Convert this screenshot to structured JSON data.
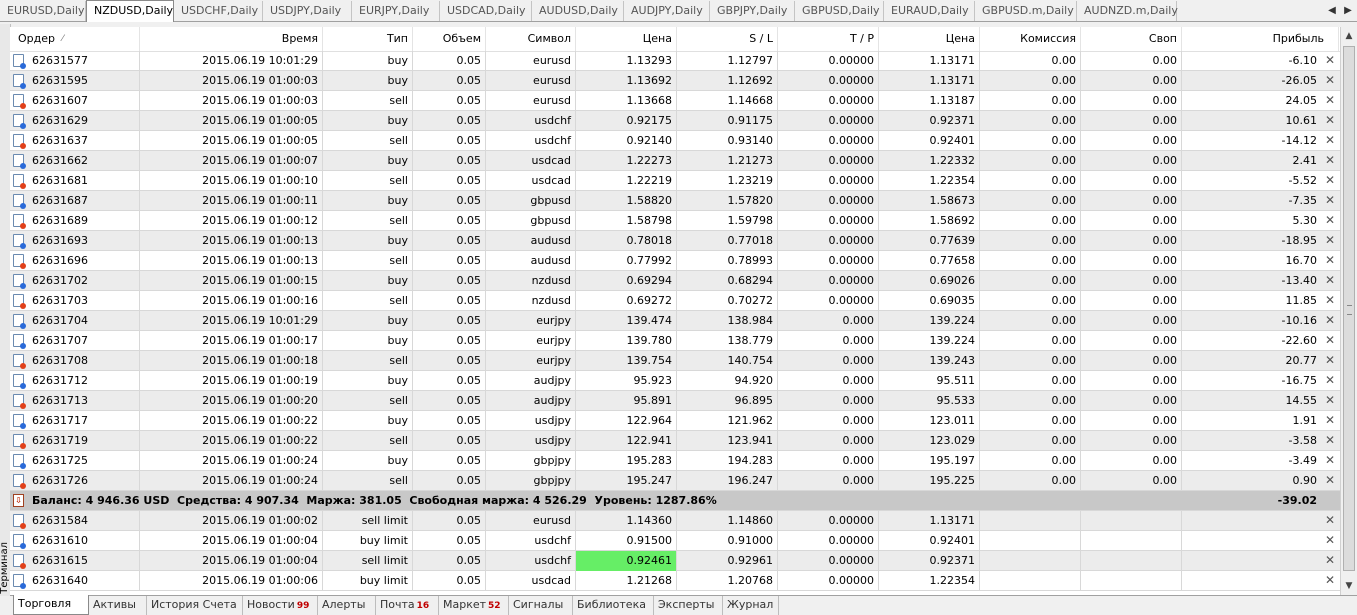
{
  "chart_tabs": [
    "EURUSD,Daily",
    "NZDUSD,Daily",
    "USDCHF,Daily",
    "USDJPY,Daily",
    "EURJPY,Daily",
    "USDCAD,Daily",
    "AUDUSD,Daily",
    "AUDJPY,Daily",
    "GBPJPY,Daily",
    "GBPUSD,Daily",
    "EURAUD,Daily",
    "GBPUSD.m,Daily",
    "AUDNZD.m,Daily"
  ],
  "chart_tabs_active": 1,
  "tab_arrows": {
    "left": "◀",
    "right": "▶"
  },
  "columns": {
    "order": "Ордер",
    "sort_indicator": "⁄",
    "time": "Время",
    "type": "Тип",
    "volume": "Объем",
    "symbol": "Символ",
    "price": "Цена",
    "sl": "S / L",
    "tp": "T / P",
    "cur_price": "Цена",
    "commission": "Комиссия",
    "swap": "Своп",
    "profit": "Прибыль"
  },
  "trades": [
    {
      "order": "62631577",
      "time": "2015.06.19 10:01:29",
      "type": "buy",
      "volume": "0.05",
      "symbol": "eurusd",
      "price": "1.13293",
      "sl": "1.12797",
      "tp": "0.00000",
      "cur_price": "1.13171",
      "commission": "0.00",
      "swap": "0.00",
      "profit": "-6.10"
    },
    {
      "order": "62631595",
      "time": "2015.06.19 01:00:03",
      "type": "buy",
      "volume": "0.05",
      "symbol": "eurusd",
      "price": "1.13692",
      "sl": "1.12692",
      "tp": "0.00000",
      "cur_price": "1.13171",
      "commission": "0.00",
      "swap": "0.00",
      "profit": "-26.05"
    },
    {
      "order": "62631607",
      "time": "2015.06.19 01:00:03",
      "type": "sell",
      "volume": "0.05",
      "symbol": "eurusd",
      "price": "1.13668",
      "sl": "1.14668",
      "tp": "0.00000",
      "cur_price": "1.13187",
      "commission": "0.00",
      "swap": "0.00",
      "profit": "24.05"
    },
    {
      "order": "62631629",
      "time": "2015.06.19 01:00:05",
      "type": "buy",
      "volume": "0.05",
      "symbol": "usdchf",
      "price": "0.92175",
      "sl": "0.91175",
      "tp": "0.00000",
      "cur_price": "0.92371",
      "commission": "0.00",
      "swap": "0.00",
      "profit": "10.61"
    },
    {
      "order": "62631637",
      "time": "2015.06.19 01:00:05",
      "type": "sell",
      "volume": "0.05",
      "symbol": "usdchf",
      "price": "0.92140",
      "sl": "0.93140",
      "tp": "0.00000",
      "cur_price": "0.92401",
      "commission": "0.00",
      "swap": "0.00",
      "profit": "-14.12"
    },
    {
      "order": "62631662",
      "time": "2015.06.19 01:00:07",
      "type": "buy",
      "volume": "0.05",
      "symbol": "usdcad",
      "price": "1.22273",
      "sl": "1.21273",
      "tp": "0.00000",
      "cur_price": "1.22332",
      "commission": "0.00",
      "swap": "0.00",
      "profit": "2.41"
    },
    {
      "order": "62631681",
      "time": "2015.06.19 01:00:10",
      "type": "sell",
      "volume": "0.05",
      "symbol": "usdcad",
      "price": "1.22219",
      "sl": "1.23219",
      "tp": "0.00000",
      "cur_price": "1.22354",
      "commission": "0.00",
      "swap": "0.00",
      "profit": "-5.52"
    },
    {
      "order": "62631687",
      "time": "2015.06.19 01:00:11",
      "type": "buy",
      "volume": "0.05",
      "symbol": "gbpusd",
      "price": "1.58820",
      "sl": "1.57820",
      "tp": "0.00000",
      "cur_price": "1.58673",
      "commission": "0.00",
      "swap": "0.00",
      "profit": "-7.35"
    },
    {
      "order": "62631689",
      "time": "2015.06.19 01:00:12",
      "type": "sell",
      "volume": "0.05",
      "symbol": "gbpusd",
      "price": "1.58798",
      "sl": "1.59798",
      "tp": "0.00000",
      "cur_price": "1.58692",
      "commission": "0.00",
      "swap": "0.00",
      "profit": "5.30"
    },
    {
      "order": "62631693",
      "time": "2015.06.19 01:00:13",
      "type": "buy",
      "volume": "0.05",
      "symbol": "audusd",
      "price": "0.78018",
      "sl": "0.77018",
      "tp": "0.00000",
      "cur_price": "0.77639",
      "commission": "0.00",
      "swap": "0.00",
      "profit": "-18.95"
    },
    {
      "order": "62631696",
      "time": "2015.06.19 01:00:13",
      "type": "sell",
      "volume": "0.05",
      "symbol": "audusd",
      "price": "0.77992",
      "sl": "0.78993",
      "tp": "0.00000",
      "cur_price": "0.77658",
      "commission": "0.00",
      "swap": "0.00",
      "profit": "16.70"
    },
    {
      "order": "62631702",
      "time": "2015.06.19 01:00:15",
      "type": "buy",
      "volume": "0.05",
      "symbol": "nzdusd",
      "price": "0.69294",
      "sl": "0.68294",
      "tp": "0.00000",
      "cur_price": "0.69026",
      "commission": "0.00",
      "swap": "0.00",
      "profit": "-13.40"
    },
    {
      "order": "62631703",
      "time": "2015.06.19 01:00:16",
      "type": "sell",
      "volume": "0.05",
      "symbol": "nzdusd",
      "price": "0.69272",
      "sl": "0.70272",
      "tp": "0.00000",
      "cur_price": "0.69035",
      "commission": "0.00",
      "swap": "0.00",
      "profit": "11.85"
    },
    {
      "order": "62631704",
      "time": "2015.06.19 10:01:29",
      "type": "buy",
      "volume": "0.05",
      "symbol": "eurjpy",
      "price": "139.474",
      "sl": "138.984",
      "tp": "0.000",
      "cur_price": "139.224",
      "commission": "0.00",
      "swap": "0.00",
      "profit": "-10.16"
    },
    {
      "order": "62631707",
      "time": "2015.06.19 01:00:17",
      "type": "buy",
      "volume": "0.05",
      "symbol": "eurjpy",
      "price": "139.780",
      "sl": "138.779",
      "tp": "0.000",
      "cur_price": "139.224",
      "commission": "0.00",
      "swap": "0.00",
      "profit": "-22.60"
    },
    {
      "order": "62631708",
      "time": "2015.06.19 01:00:18",
      "type": "sell",
      "volume": "0.05",
      "symbol": "eurjpy",
      "price": "139.754",
      "sl": "140.754",
      "tp": "0.000",
      "cur_price": "139.243",
      "commission": "0.00",
      "swap": "0.00",
      "profit": "20.77"
    },
    {
      "order": "62631712",
      "time": "2015.06.19 01:00:19",
      "type": "buy",
      "volume": "0.05",
      "symbol": "audjpy",
      "price": "95.923",
      "sl": "94.920",
      "tp": "0.000",
      "cur_price": "95.511",
      "commission": "0.00",
      "swap": "0.00",
      "profit": "-16.75"
    },
    {
      "order": "62631713",
      "time": "2015.06.19 01:00:20",
      "type": "sell",
      "volume": "0.05",
      "symbol": "audjpy",
      "price": "95.891",
      "sl": "96.895",
      "tp": "0.000",
      "cur_price": "95.533",
      "commission": "0.00",
      "swap": "0.00",
      "profit": "14.55"
    },
    {
      "order": "62631717",
      "time": "2015.06.19 01:00:22",
      "type": "buy",
      "volume": "0.05",
      "symbol": "usdjpy",
      "price": "122.964",
      "sl": "121.962",
      "tp": "0.000",
      "cur_price": "123.011",
      "commission": "0.00",
      "swap": "0.00",
      "profit": "1.91"
    },
    {
      "order": "62631719",
      "time": "2015.06.19 01:00:22",
      "type": "sell",
      "volume": "0.05",
      "symbol": "usdjpy",
      "price": "122.941",
      "sl": "123.941",
      "tp": "0.000",
      "cur_price": "123.029",
      "commission": "0.00",
      "swap": "0.00",
      "profit": "-3.58"
    },
    {
      "order": "62631725",
      "time": "2015.06.19 01:00:24",
      "type": "buy",
      "volume": "0.05",
      "symbol": "gbpjpy",
      "price": "195.283",
      "sl": "194.283",
      "tp": "0.000",
      "cur_price": "195.197",
      "commission": "0.00",
      "swap": "0.00",
      "profit": "-3.49"
    },
    {
      "order": "62631726",
      "time": "2015.06.19 01:00:24",
      "type": "sell",
      "volume": "0.05",
      "symbol": "gbpjpy",
      "price": "195.247",
      "sl": "196.247",
      "tp": "0.000",
      "cur_price": "195.225",
      "commission": "0.00",
      "swap": "0.00",
      "profit": "0.90"
    }
  ],
  "balance": {
    "text": "Баланс: 4 946.36 USD  Средства: 4 907.34  Маржа: 381.05  Свободная маржа: 4 526.29  Уровень: 1287.86%",
    "total_profit": "-39.02"
  },
  "pending": [
    {
      "order": "62631584",
      "time": "2015.06.19 01:00:02",
      "type": "sell limit",
      "volume": "0.05",
      "symbol": "eurusd",
      "price": "1.14360",
      "sl": "1.14860",
      "tp": "0.00000",
      "cur_price": "1.13171",
      "highlight": false
    },
    {
      "order": "62631610",
      "time": "2015.06.19 01:00:04",
      "type": "buy limit",
      "volume": "0.05",
      "symbol": "usdchf",
      "price": "0.91500",
      "sl": "0.91000",
      "tp": "0.00000",
      "cur_price": "0.92401",
      "highlight": false
    },
    {
      "order": "62631615",
      "time": "2015.06.19 01:00:04",
      "type": "sell limit",
      "volume": "0.05",
      "symbol": "usdchf",
      "price": "0.92461",
      "sl": "0.92961",
      "tp": "0.00000",
      "cur_price": "0.92371",
      "highlight": true
    },
    {
      "order": "62631640",
      "time": "2015.06.19 01:00:06",
      "type": "buy limit",
      "volume": "0.05",
      "symbol": "usdcad",
      "price": "1.21268",
      "sl": "1.20768",
      "tp": "0.00000",
      "cur_price": "1.22354",
      "highlight": false
    }
  ],
  "close_glyph": "✕",
  "side_label": "Терминал",
  "bottom_tabs": [
    {
      "label": "Торговля",
      "badge": ""
    },
    {
      "label": "Активы",
      "badge": ""
    },
    {
      "label": "История Счета",
      "badge": ""
    },
    {
      "label": "Новости",
      "badge": "99"
    },
    {
      "label": "Алерты",
      "badge": ""
    },
    {
      "label": "Почта",
      "badge": "16"
    },
    {
      "label": "Маркет",
      "badge": "52"
    },
    {
      "label": "Сигналы",
      "badge": ""
    },
    {
      "label": "Библиотека",
      "badge": ""
    },
    {
      "label": "Эксперты",
      "badge": ""
    },
    {
      "label": "Журнал",
      "badge": ""
    }
  ],
  "bottom_tabs_active": 0,
  "colors": {
    "highlight": "#66ee66",
    "buy_dot": "#2a6ad8",
    "sell_dot": "#e0401a",
    "balance_row": "#c8c8c8",
    "alt_row": "#ececec"
  }
}
